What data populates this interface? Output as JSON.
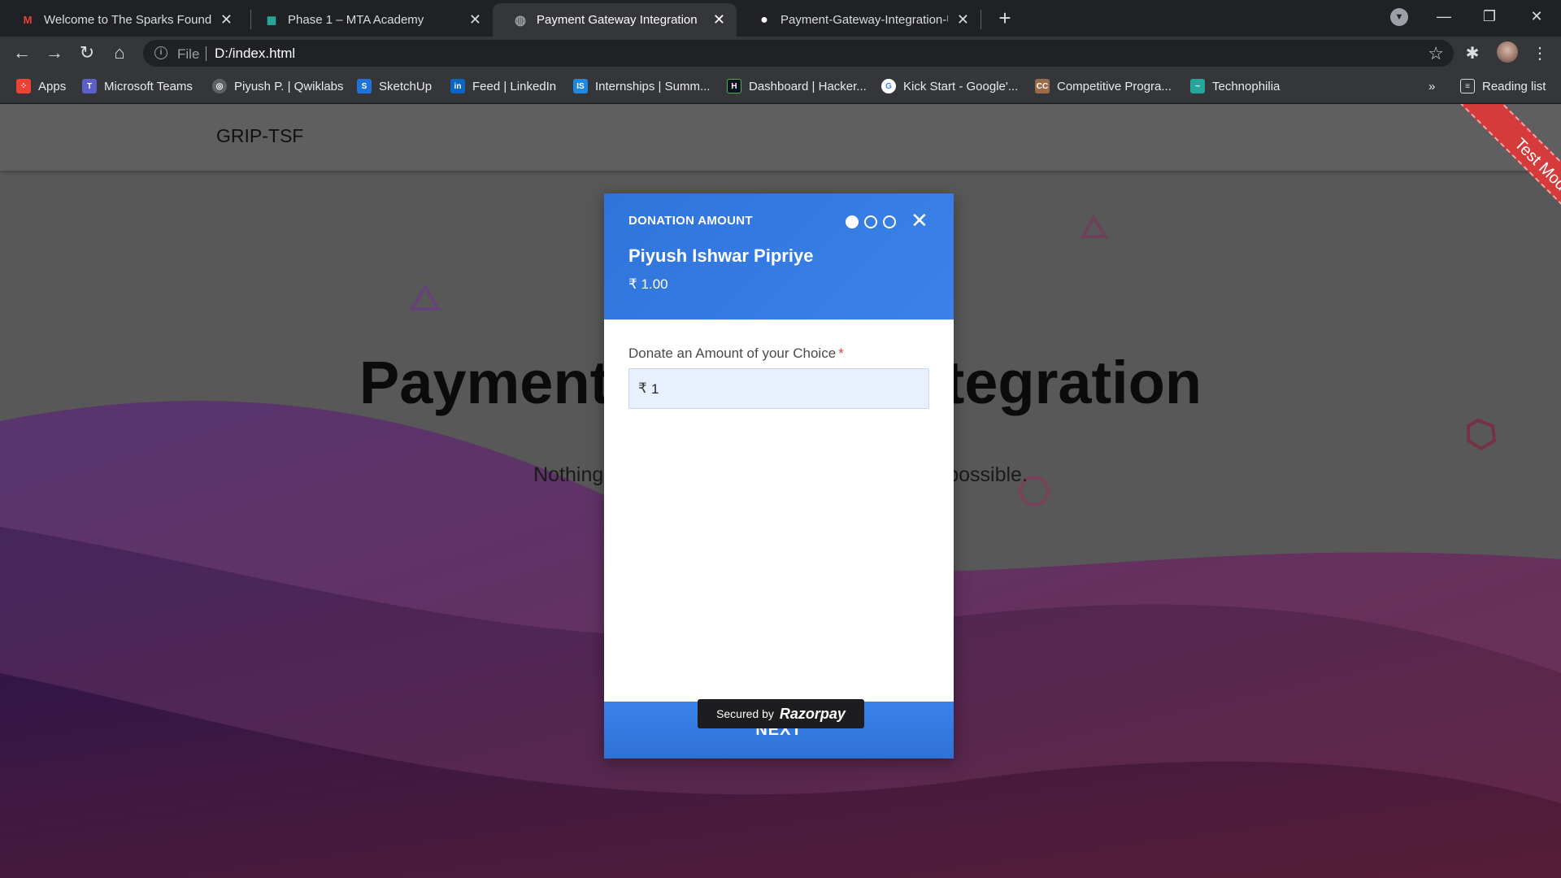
{
  "browser": {
    "tabs": [
      {
        "title": "Welcome to The Sparks Foundati",
        "icon": "gmail-icon"
      },
      {
        "title": "Phase 1 – MTA Academy",
        "icon": "mta-icon"
      },
      {
        "title": "Payment Gateway Integration",
        "icon": "globe-icon"
      },
      {
        "title": "Payment-Gateway-Integration-U",
        "icon": "github-icon"
      }
    ],
    "url_scheme": "File",
    "url": "D:/index.html",
    "bookmarks": [
      {
        "label": "Apps",
        "color": "#ea4335"
      },
      {
        "label": "Microsoft Teams",
        "color": "#5b5fc7"
      },
      {
        "label": "Piyush P. | Qwiklabs",
        "color": "#e8eaed"
      },
      {
        "label": "SketchUp",
        "color": "#1f73d8"
      },
      {
        "label": "Feed | LinkedIn",
        "color": "#0a66c2"
      },
      {
        "label": "Internships | Summ...",
        "color": "#1e88e5"
      },
      {
        "label": "Dashboard | Hacker...",
        "color": "#0e141e"
      },
      {
        "label": "Kick Start - Google'...",
        "color": "#4285f4"
      },
      {
        "label": "Competitive Progra...",
        "color": "#9b6b4a"
      },
      {
        "label": "Technophilia",
        "color": "#26a69a"
      }
    ],
    "bookmarks_more": "»",
    "reading_list": "Reading list"
  },
  "site": {
    "brand": "GRIP-TSF",
    "hero_title": "Payment Gateway Integration",
    "hero_subtitle": "Nothing is impossible, the word itself says I'm possible.",
    "test_mode": "Test Mode"
  },
  "checkout": {
    "header_label": "DONATION AMOUNT",
    "merchant_name": "Piyush Ishwar Pipriye",
    "amount": "₹ 1.00",
    "field_label": "Donate an Amount of your Choice",
    "required_mark": "*",
    "currency_symbol": "₹",
    "field_value": "1",
    "next_label": "NEXT",
    "steps_total": 3,
    "step_current": 1,
    "secured_label": "Secured by",
    "secured_brand": "Razorpay",
    "accent": "#3a82ea"
  }
}
